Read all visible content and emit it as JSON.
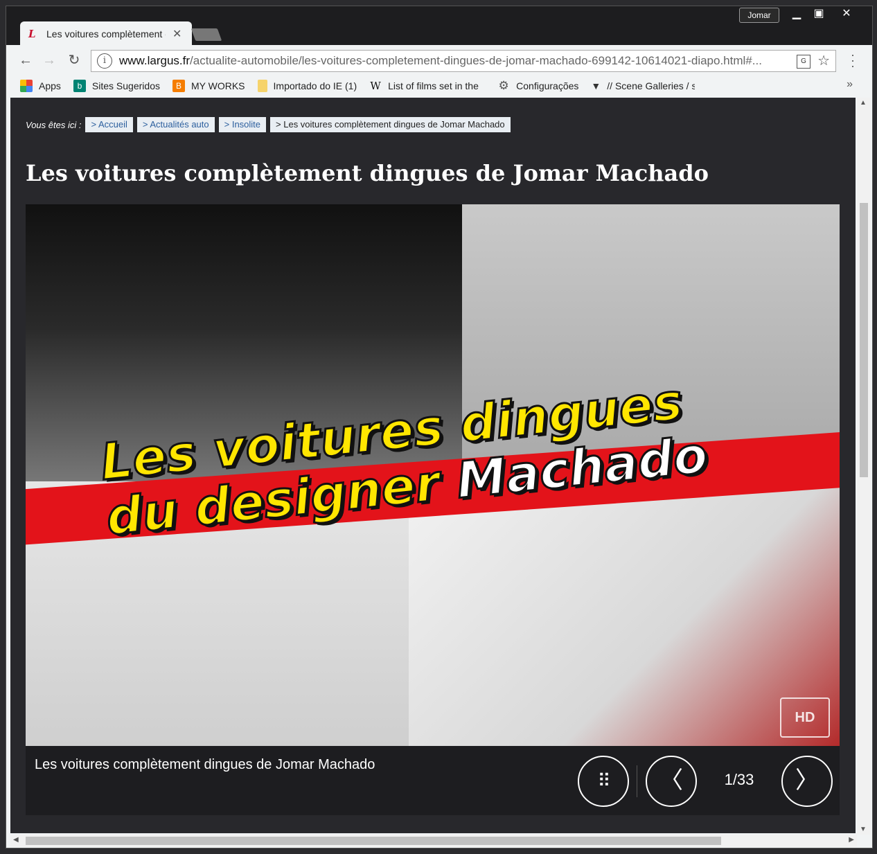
{
  "browser": {
    "tab_title": "Les voitures complètement dingues de Jomar Machado",
    "tab_close": "✕",
    "user_badge": "Jomar",
    "window_min": "▁",
    "window_max": "▣",
    "window_close": "✕",
    "url_domain": "www.largus.fr",
    "url_path": "/actualite-automobile/les-voitures-completement-dingues-de-jomar-machado-699142-10614021-diapo.html#...",
    "bookmarks": [
      {
        "label": "Apps",
        "icon": "apps-grid-icon",
        "color": "#e94235"
      },
      {
        "label": "Sites Sugeridos",
        "icon": "bing-icon",
        "color": "#008373"
      },
      {
        "label": "MY WORKS",
        "icon": "blogger-icon",
        "color": "#f57d00"
      },
      {
        "label": "Importado do IE (1)",
        "icon": "folder-icon",
        "color": "#f6d36b"
      },
      {
        "label": "List of films set in the",
        "icon": "wikipedia-icon",
        "color": "#ffffff"
      },
      {
        "label": "Configurações",
        "icon": "gear-icon",
        "color": "#555555"
      },
      {
        "label": "// Scene Galleries / sc",
        "icon": "scene-logo-icon",
        "color": "#333333"
      }
    ],
    "bookmarks_more": "»"
  },
  "page": {
    "breadcrumb_lead": "Vous êtes ici :",
    "breadcrumbs": [
      "> Accueil",
      "> Actualités auto",
      "> Insolite",
      "> Les voitures complètement dingues de Jomar Machado"
    ],
    "title": "Les voitures complètement dingues de Jomar Machado"
  },
  "slideshow": {
    "banner_line1": "Les voitures dingues",
    "banner_line2_a": "du designer ",
    "banner_line2_b": "Machado",
    "hd_badge": "HD",
    "caption": "Les voitures complètement dingues de Jomar Machado",
    "counter": "1/33",
    "prev_glyph": "〈",
    "next_glyph": "〉",
    "grid_glyph": "⠿"
  },
  "colors": {
    "page_bg": "#28282c",
    "breadcrumb_link": "#2c5f9e",
    "banner_red": "#e3131a",
    "banner_yellow": "#ffe600"
  }
}
